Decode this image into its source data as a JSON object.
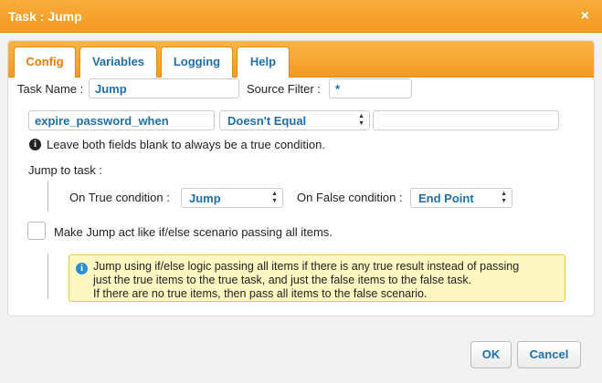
{
  "dialog": {
    "title": "Task : Jump",
    "close_glyph": "×"
  },
  "tabs": [
    {
      "label": "Config",
      "active": true
    },
    {
      "label": "Variables",
      "active": false
    },
    {
      "label": "Logging",
      "active": false
    },
    {
      "label": "Help",
      "active": false
    }
  ],
  "config": {
    "task_name_label": "Task Name :",
    "task_name_value": "Jump",
    "source_filter_label": "Source Filter :",
    "source_filter_value": "*",
    "condition_field": "expire_password_when",
    "condition_operator": "Doesn't Equal",
    "condition_value": "",
    "hint_icon": "i",
    "hint_text": "Leave both fields blank to always be a true condition.",
    "jump_to_task_label": "Jump to task :",
    "on_true_label": "On True condition :",
    "on_true_value": "Jump",
    "on_false_label": "On False condition :",
    "on_false_value": "End Point",
    "ifelse_checkbox_label": "Make Jump act like if/else scenario passing all items.",
    "ifelse_checked": false,
    "note_icon": "i",
    "note_lines": [
      "Jump using if/else logic passing all items if there is any true result instead of passing",
      "just the true items to the true task, and just the false items to the false task.",
      "If there are no true items, then pass all items to the false scenario."
    ]
  },
  "footer": {
    "ok_label": "OK",
    "cancel_label": "Cancel"
  },
  "colors": {
    "accent": "#f39a22",
    "link": "#1e6fa8",
    "note_bg": "#fff7c2"
  }
}
